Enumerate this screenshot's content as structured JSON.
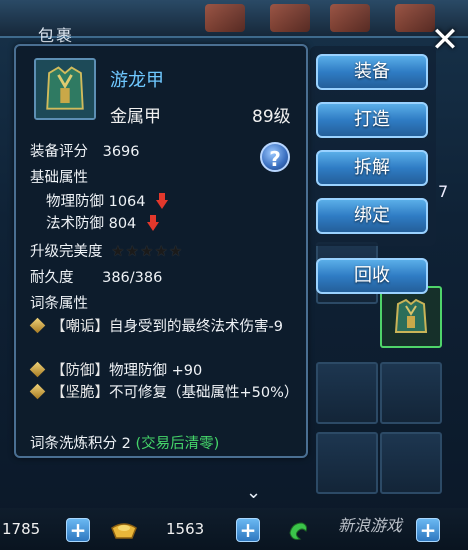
{
  "bag": {
    "title": "包裹",
    "close_symbol": "✕",
    "side_count": "7"
  },
  "item": {
    "name": "游龙甲",
    "type": "金属甲",
    "level": "89级",
    "icon": "armor-icon",
    "score_label": "装备评分",
    "score": "3696",
    "base_attr_label": "基础属性",
    "phys_def_label": "物理防御",
    "phys_def": "1064",
    "magic_def_label": "法术防御",
    "magic_def": "804",
    "upgrade_label": "升级完美度",
    "upgrade_stars": "★★★★★",
    "upgrade_stars_filled": 0,
    "durability_label": "耐久度",
    "durability": "386/386",
    "affix_label": "词条属性",
    "affixes": [
      {
        "tag": "【嘲诟】",
        "text": "自身受到的最终法术伤害-9"
      },
      {
        "tag": "【防御】",
        "text": "物理防御 +90"
      },
      {
        "tag": "【坚脆】",
        "text": "不可修复（基础属性+50%）"
      }
    ],
    "refine_label": "词条洗炼积分 2",
    "refine_note": "(交易后清零)"
  },
  "help_symbol": "?",
  "actions": {
    "equip": "装备",
    "forge": "打造",
    "dismantle": "拆解",
    "bind": "绑定",
    "recycle": "回收"
  },
  "scroll_symbol": "⌄",
  "currency": {
    "left_value": "1785",
    "gold_value": "1563",
    "plus_symbol": "+"
  },
  "watermark": "新浪游戏",
  "colors": {
    "name_blue": "#6fc8ff",
    "affix_green": "#45d66a",
    "button_blue": "#2f7cc4",
    "arrow_red": "#e2382c",
    "highlight_green": "#4fd46a"
  }
}
